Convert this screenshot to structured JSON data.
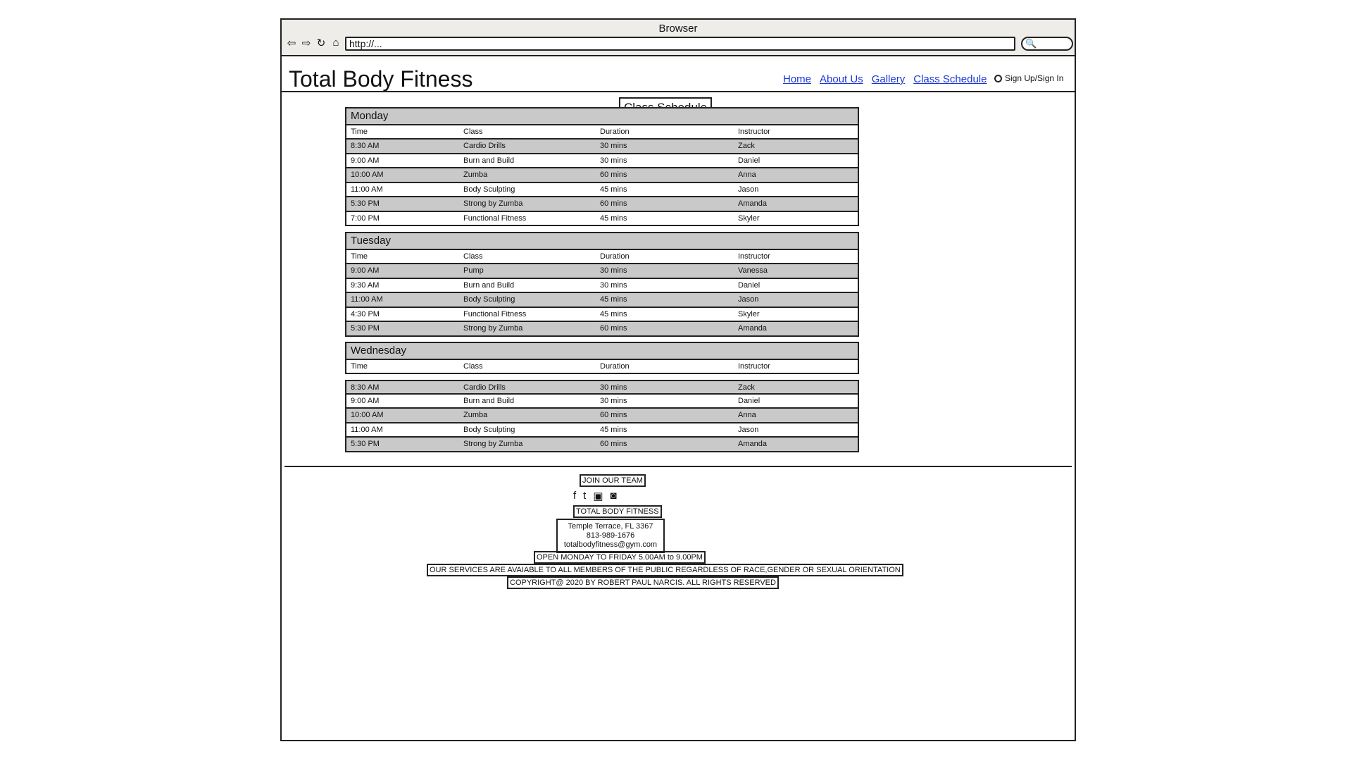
{
  "browser": {
    "title": "Browser",
    "url": "http://...",
    "nav_icons": [
      "back-arrow-icon",
      "forward-arrow-icon",
      "refresh-icon",
      "home-icon"
    ],
    "search_icon": "search-icon"
  },
  "site": {
    "title": "Total Body Fitness",
    "nav": [
      "Home",
      "About Us",
      "Gallery",
      "Class Schedule"
    ],
    "signin": "Sign Up/Sign In"
  },
  "page_heading": "Class Schedule",
  "columns": [
    "Time",
    "Class",
    "Duration",
    "Instructor"
  ],
  "days": [
    {
      "name": "Monday",
      "rows": [
        [
          "8:30 AM",
          "Cardio Drills",
          "30 mins",
          "Zack"
        ],
        [
          "9:00 AM",
          "Burn and Build",
          "30 mins",
          "Daniel"
        ],
        [
          "10:00 AM",
          "Zumba",
          "60 mins",
          "Anna"
        ],
        [
          "11:00 AM",
          "Body Sculpting",
          "45 mins",
          "Jason"
        ],
        [
          "5:30 PM",
          "Strong by Zumba",
          "60 mins",
          "Amanda"
        ],
        [
          "7:00 PM",
          "Functional Fitness",
          "45 mins",
          "Skyler"
        ]
      ]
    },
    {
      "name": "Tuesday",
      "rows": [
        [
          "9:00 AM",
          "Pump",
          "30 mins",
          "Vanessa"
        ],
        [
          "9:30 AM",
          "Burn and Build",
          "30 mins",
          "Daniel"
        ],
        [
          "11:00 AM",
          "Body Sculpting",
          "45 mins",
          "Jason"
        ],
        [
          "4:30 PM",
          "Functional Fitness",
          "45 mins",
          "Skyler"
        ],
        [
          "5:30 PM",
          "Strong by Zumba",
          "60 mins",
          "Amanda"
        ]
      ]
    },
    {
      "name": "Wednesday",
      "rows": [
        [
          "8:30 AM",
          "Cardio Drills",
          "30 mins",
          "Zack"
        ],
        [
          "9:00 AM",
          "Burn and Build",
          "30 mins",
          "Daniel"
        ],
        [
          "10:00 AM",
          "Zumba",
          "60 mins",
          "Anna"
        ],
        [
          "11:00 AM",
          "Body Sculpting",
          "45 mins",
          "Jason"
        ],
        [
          "5:30 PM",
          "Strong by Zumba",
          "60 mins",
          "Amanda"
        ]
      ]
    }
  ],
  "footer": {
    "join": "JOIN OUR TEAM",
    "socials": [
      "facebook-icon",
      "twitter-icon",
      "video-icon",
      "rss-icon"
    ],
    "name": "TOTAL BODY FITNESS",
    "address": "Temple Terrace, FL 3367",
    "phone": "813-989-1676",
    "email": "totalbodyfitness@gym.com",
    "hours": "OPEN MONDAY TO FRIDAY 5.00AM to 9.00PM",
    "services": "OUR SERVICES ARE AVAIABLE TO ALL MEMBERS OF THE PUBLIC REGARDLESS OF RACE,GENDER OR SEXUAL ORIENTATION",
    "copyright": "COPYRIGHT@ 2020 BY ROBERT PAUL NARCIS. ALL RIGHTS RESERVED"
  }
}
